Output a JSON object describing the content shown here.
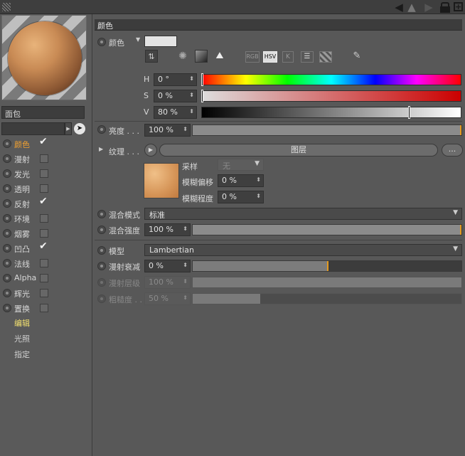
{
  "section_title": "颜色",
  "material_name": "面包",
  "channels": [
    {
      "label": "颜色",
      "checked": true,
      "active": true
    },
    {
      "label": "漫射",
      "checked": false
    },
    {
      "label": "发光",
      "checked": false
    },
    {
      "label": "透明",
      "checked": false
    },
    {
      "label": "反射",
      "checked": true
    },
    {
      "label": "环境",
      "checked": false
    },
    {
      "label": "烟雾",
      "checked": false
    },
    {
      "label": "凹凸",
      "checked": true
    },
    {
      "label": "法线",
      "checked": false
    },
    {
      "label": "Alpha",
      "checked": false
    },
    {
      "label": "辉光",
      "checked": false
    },
    {
      "label": "置换",
      "checked": false
    }
  ],
  "sub_items": [
    {
      "label": "编辑",
      "active": true
    },
    {
      "label": "光照"
    },
    {
      "label": "指定"
    }
  ],
  "color": {
    "label": "颜色",
    "swatch": "#e4e4e4",
    "mode_buttons": [
      "RGB",
      "HSV",
      "K"
    ],
    "active_mode": "HSV",
    "h_label": "H",
    "h_value": "0 °",
    "s_label": "S",
    "s_value": "0 %",
    "v_label": "V",
    "v_value": "80 %",
    "v_fraction": 0.8
  },
  "brightness": {
    "label": "亮度 . . .",
    "value": "100 %",
    "fraction": 1.0
  },
  "texture": {
    "label": "纹理 . . .",
    "layer_button": "图层",
    "more_button": "...",
    "sampling_label": "采样",
    "sampling_value": "无",
    "blur_offset_label": "模糊偏移",
    "blur_offset_value": "0 %",
    "blur_scale_label": "模糊程度",
    "blur_scale_value": "0 %"
  },
  "mix_mode": {
    "label": "混合模式",
    "value": "标准"
  },
  "mix_strength": {
    "label": "混合强度",
    "value": "100 %",
    "fraction": 1.0
  },
  "model": {
    "label": "模型",
    "value": "Lambertian"
  },
  "diffuse_falloff": {
    "label": "漫射衰减",
    "value": "0 %",
    "fraction": 0.0
  },
  "diffuse_level": {
    "label": "漫射层级",
    "value": "100 %",
    "fraction": 1.0
  },
  "roughness": {
    "label": "粗糙度 . .",
    "value": "50 %",
    "fraction": 0.25
  },
  "colors": {
    "accent": "#f0a030",
    "marker": "#e39a20",
    "panel": "#585858"
  }
}
